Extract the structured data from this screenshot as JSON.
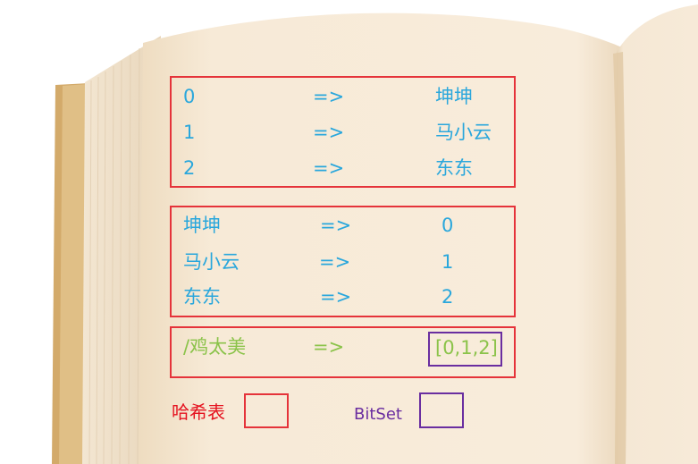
{
  "table_index_to_name": {
    "rows": [
      {
        "key": "0",
        "arrow": "=>",
        "value": "坤坤"
      },
      {
        "key": "1",
        "arrow": "=>",
        "value": "马小云"
      },
      {
        "key": "2",
        "arrow": "=>",
        "value": "东东"
      }
    ]
  },
  "table_name_to_index": {
    "rows": [
      {
        "key": "坤坤",
        "arrow": "=>",
        "value": "0"
      },
      {
        "key": "马小云",
        "arrow": "=>",
        "value": "1"
      },
      {
        "key": "东东",
        "arrow": "=>",
        "value": "2"
      }
    ]
  },
  "inverted_entry": {
    "key": "/鸡太美",
    "arrow": "=>",
    "value": "[0,1,2]"
  },
  "legend": {
    "hash_label": "哈希表",
    "bitset_label": "BitSet"
  },
  "colors": {
    "text_blue": "#2aa7dc",
    "text_green": "#8bc34a",
    "hash_red": "#e5333a",
    "bitset_purple": "#6a2ea0",
    "page": "#f7ead7",
    "page_edge": "#d8b47a"
  }
}
